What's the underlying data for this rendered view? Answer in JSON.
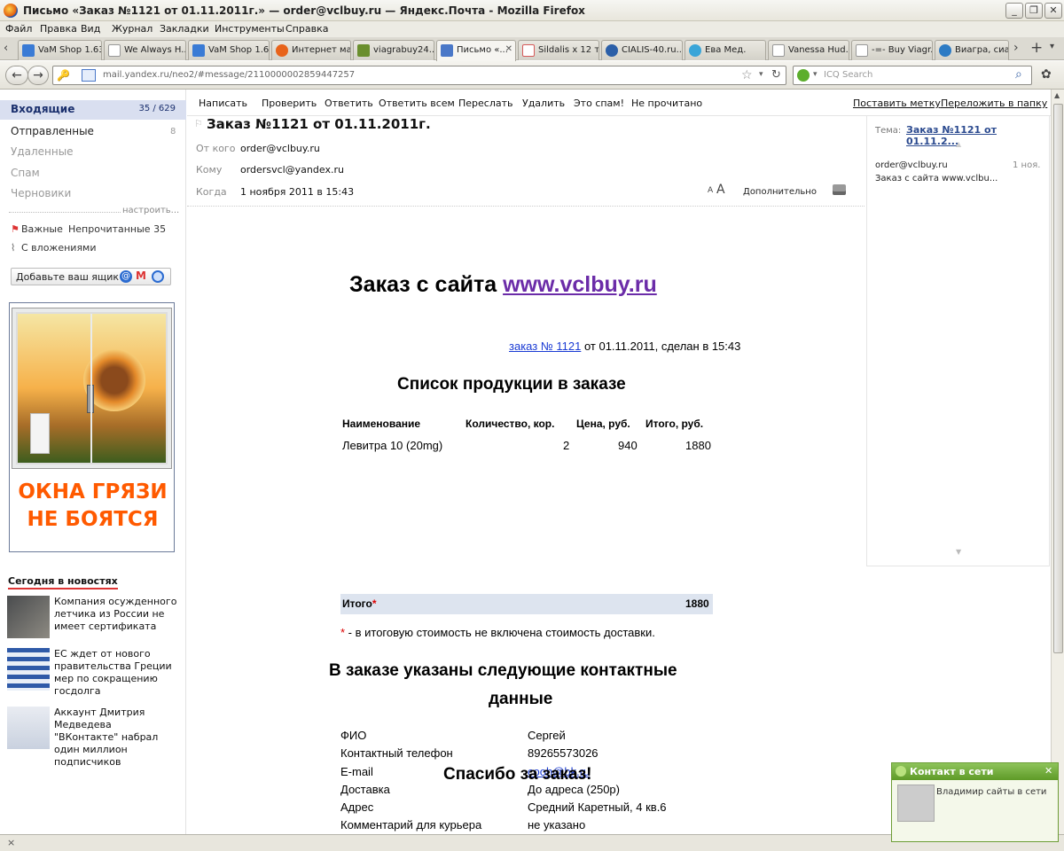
{
  "window": {
    "title": "Письмо «Заказ №1121 от 01.11.2011г.» — order@vclbuy.ru — Яндекс.Почта - Mozilla Firefox"
  },
  "menu": [
    "Файл",
    "Правка",
    "Вид",
    "Журнал",
    "Закладки",
    "Инструменты",
    "Справка"
  ],
  "tabs": [
    {
      "label": "VaM Shop 1.63",
      "icon_color": "#3a7bd5"
    },
    {
      "label": "We Always H...",
      "icon_color": "#bbb"
    },
    {
      "label": "VaM Shop 1.63",
      "icon_color": "#3a7bd5"
    },
    {
      "label": "Интернет ма...",
      "icon_color": "#e8631a"
    },
    {
      "label": "viagrabuy24....",
      "icon_color": "#6a8f2e"
    },
    {
      "label": "Письмо «...",
      "icon_color": "#4a78c8"
    },
    {
      "label": "Sildalis x 12 т...",
      "icon_color": "#d65b5b"
    },
    {
      "label": "CIALIS-40.ru...",
      "icon_color": "#2b5fa8"
    },
    {
      "label": "Ева Мед.",
      "icon_color": "#3aa5d8"
    },
    {
      "label": "Vanessa Hud...",
      "icon_color": "#bbb"
    },
    {
      "label": "-=- Buy Viagr...",
      "icon_color": "#bbb"
    },
    {
      "label": "Виагра, сиа...",
      "icon_color": "#2d7bc4"
    }
  ],
  "nav": {
    "url": "mail.yandex.ru/neo2/#message/2110000002859447257",
    "search_placeholder": "ICQ Search"
  },
  "sidebar": {
    "inbox": "Входящие",
    "inbox_count": "35 / 629",
    "sent": "Отправленные",
    "sent_count": "8",
    "deleted": "Удаленные",
    "spam": "Спам",
    "drafts": "Черновики",
    "setup": "настроить...",
    "important": "Важные",
    "unread": "Непрочитанные 35",
    "attachments": "С вложениями",
    "add_box": "Добавьте ваш ящик",
    "ad_line1": "ОКНА ГРЯЗИ",
    "ad_line2": "НЕ БОЯТСЯ",
    "news_title": "Сегодня в новостях",
    "news": [
      "Компания осужденного летчика из России не имеет сертификата",
      "ЕС ждет от нового правительства Греции мер по сокращению госдолга",
      "Аккаунт Дмитрия Медведева \"ВКонтакте\" набрал один миллион подписчиков"
    ]
  },
  "toolbar": [
    "Написать",
    "Проверить",
    "Ответить",
    "Ответить всем",
    "Переслать",
    "Удалить",
    "Это спам!",
    "Не прочитано"
  ],
  "toolbar_right": [
    "Поставить метку",
    "Переложить в папку"
  ],
  "message": {
    "subject": "Заказ №1121 от 01.11.2011г.",
    "from_label": "От кого",
    "from": "order@vclbuy.ru",
    "to_label": "Кому",
    "to": "ordersvcl@yandex.ru",
    "when_label": "Когда",
    "when": "1 ноября 2011 в 15:43",
    "more": "Дополнительно"
  },
  "thread": {
    "label": "Тема:",
    "subject": "Заказ №1121 от 01.11.2...",
    "from": "order@vclbuy.ru",
    "date": "1 ноя.",
    "snippet": "Заказ с сайта www.vclbu..."
  },
  "order": {
    "heading_prefix": "Заказ с сайта ",
    "site": "www.vclbuy.ru",
    "order_link": "заказ № 1121",
    "order_info": " от 01.11.2011, сделан в 15:43",
    "products_title": "Список продукции в заказе",
    "columns": [
      "Наименование",
      "Количество, кор.",
      "Цена, руб.",
      "Итого, руб."
    ],
    "rows": [
      {
        "name": "Левитра 10 (20mg)",
        "qty": "2",
        "price": "940",
        "total": "1880"
      }
    ],
    "total_label": "Итого",
    "total_star": "*",
    "total": "1880",
    "note_star": "*",
    "note": " - в итоговую стоимость не включена стоимость доставки.",
    "contacts_title_1": "В заказе указаны следующие контактные",
    "contacts_title_2": "данные",
    "contacts": [
      {
        "k": "ФИО",
        "v": "Сергей"
      },
      {
        "k": "Контактный телефон",
        "v": "89265573026"
      },
      {
        "k": "E-mail",
        "v": "cooh@bk.ru"
      },
      {
        "k": "Доставка",
        "v": "До адреса (250р)"
      },
      {
        "k": "Адрес",
        "v": "Средний Каретный, 4 кв.6"
      },
      {
        "k": "Комментарий для курьера",
        "v": "не указано"
      }
    ],
    "thanks": "Спасибо за заказ!"
  },
  "popup": {
    "title": "Контакт в сети",
    "text": "Владимир сайты в сети"
  }
}
